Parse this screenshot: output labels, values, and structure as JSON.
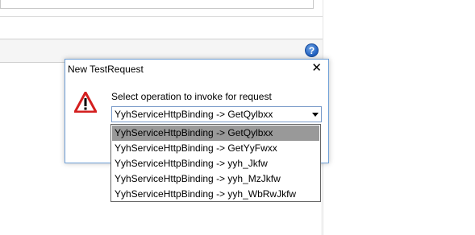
{
  "help": {
    "glyph": "?"
  },
  "dialog": {
    "title": "New TestRequest",
    "close_glyph": "✕",
    "prompt": "Select operation to invoke for request",
    "selected_value": "YyhServiceHttpBinding -> GetQylbxx"
  },
  "dropdown": {
    "options": [
      {
        "label": "YyhServiceHttpBinding -> GetQylbxx",
        "selected": true
      },
      {
        "label": "YyhServiceHttpBinding -> GetYyFwxx",
        "selected": false
      },
      {
        "label": "YyhServiceHttpBinding -> yyh_Jkfw",
        "selected": false
      },
      {
        "label": "YyhServiceHttpBinding -> yyh_MzJkfw",
        "selected": false
      },
      {
        "label": "YyhServiceHttpBinding -> yyh_WbRwJkfw",
        "selected": false
      }
    ]
  },
  "colors": {
    "selection_bg": "#999999",
    "dialog_border": "#6e9fd6",
    "warning_red": "#d41f1f"
  },
  "icons": {
    "help": "help-icon",
    "warning": "warning-icon",
    "close": "close-icon",
    "dropdown": "chevron-down-icon"
  }
}
